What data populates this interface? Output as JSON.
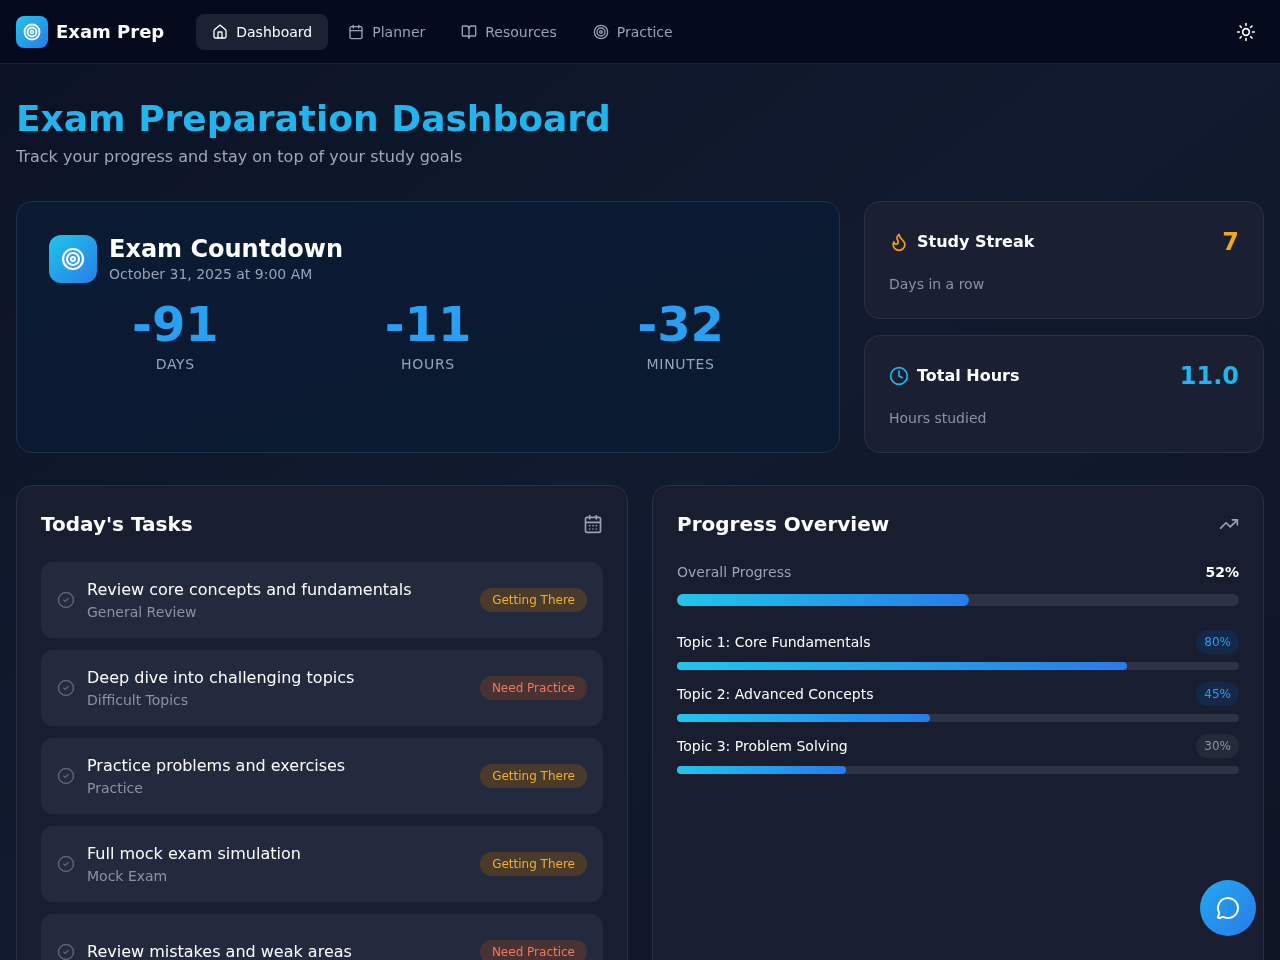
{
  "app": {
    "name": "Exam Prep"
  },
  "nav": [
    {
      "label": "Dashboard",
      "kind": "home",
      "selected": true
    },
    {
      "label": "Planner",
      "kind": "planner",
      "selected": false
    },
    {
      "label": "Resources",
      "kind": "resources",
      "selected": false
    },
    {
      "label": "Practice",
      "kind": "practice",
      "selected": false
    }
  ],
  "header": {
    "title": "Exam Preparation Dashboard",
    "subtitle": "Track your progress and stay on top of your study goals"
  },
  "countdown": {
    "title": "Exam Countdown",
    "date": "October 31, 2025 at 9:00 AM",
    "units": [
      {
        "value": "-91",
        "label": "DAYS"
      },
      {
        "value": "-11",
        "label": "HOURS"
      },
      {
        "value": "-32",
        "label": "MINUTES"
      }
    ]
  },
  "stats": [
    {
      "kind": "streak",
      "title": "Study Streak",
      "value": "7",
      "caption": "Days in a row"
    },
    {
      "kind": "hours",
      "title": "Total Hours",
      "value": "11.0",
      "caption": "Hours studied"
    }
  ],
  "tasks": {
    "title": "Today's Tasks",
    "items": [
      {
        "title": "Review core concepts and fundamentals",
        "category": "General Review",
        "badge": "Getting There",
        "kind": "getting_there"
      },
      {
        "title": "Deep dive into challenging topics",
        "category": "Difficult Topics",
        "badge": "Need Practice",
        "kind": "need_practice"
      },
      {
        "title": "Practice problems and exercises",
        "category": "Practice",
        "badge": "Getting There",
        "kind": "getting_there"
      },
      {
        "title": "Full mock exam simulation",
        "category": "Mock Exam",
        "badge": "Getting There",
        "kind": "getting_there"
      },
      {
        "title": "Review mistakes and weak areas",
        "badge": "Need Practice",
        "kind": "need_practice"
      }
    ]
  },
  "progress": {
    "title": "Progress Overview",
    "overall": {
      "label": "Overall Progress",
      "reading": "52%",
      "level": 0.52
    },
    "topics": [
      {
        "label": "Topic 1: Core Fundamentals",
        "reading": "80%",
        "level": 0.8
      },
      {
        "label": "Topic 2: Advanced Concepts",
        "reading": "45%",
        "level": 0.45
      },
      {
        "label": "Topic 3: Problem Solving",
        "reading": "30%",
        "level": 0.3
      }
    ]
  }
}
